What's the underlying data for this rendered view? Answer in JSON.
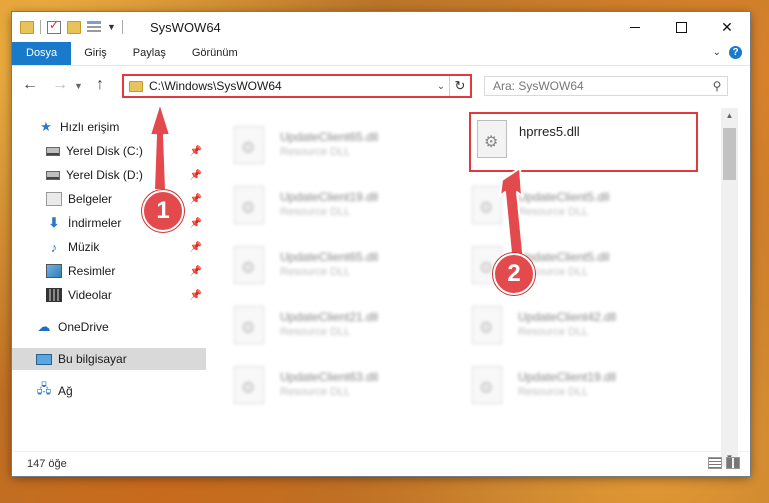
{
  "window": {
    "title": "SysWOW64",
    "controls": {
      "minimize": "—",
      "maximize": "☐",
      "close": "✕"
    }
  },
  "ribbon": {
    "tabs": [
      "Dosya",
      "Giriş",
      "Paylaş",
      "Görünüm"
    ],
    "active_tab": "Dosya"
  },
  "address": {
    "path": "C:\\Windows\\SysWOW64",
    "search_placeholder": "Ara: SysWOW64"
  },
  "sidebar": {
    "items": [
      {
        "label": "Hızlı erişim",
        "icon": "star-icon",
        "pinned": false
      },
      {
        "label": "Yerel Disk (C:)",
        "icon": "drive-icon",
        "pinned": true
      },
      {
        "label": "Yerel Disk (D:)",
        "icon": "drive-icon",
        "pinned": true
      },
      {
        "label": "Belgeler",
        "icon": "documents-icon",
        "pinned": true
      },
      {
        "label": "İndirmeler",
        "icon": "download-icon",
        "pinned": true
      },
      {
        "label": "Müzik",
        "icon": "music-icon",
        "pinned": true
      },
      {
        "label": "Resimler",
        "icon": "pictures-icon",
        "pinned": true
      },
      {
        "label": "Videolar",
        "icon": "videos-icon",
        "pinned": true
      },
      {
        "label": "OneDrive",
        "icon": "cloud-icon",
        "pinned": false
      },
      {
        "label": "Bu bilgisayar",
        "icon": "computer-icon",
        "pinned": false,
        "selected": true
      },
      {
        "label": "Ağ",
        "icon": "network-icon",
        "pinned": false
      }
    ]
  },
  "files": {
    "left": [
      {
        "name": "UpdateClient65.dll",
        "type": "Resource DLL"
      },
      {
        "name": "UpdateClient19.dll",
        "type": "Resource DLL"
      },
      {
        "name": "UpdateClient65.dll",
        "type": "Resource DLL"
      },
      {
        "name": "UpdateClient21.dll",
        "type": "Resource DLL"
      },
      {
        "name": "UpdateClient63.dll",
        "type": "Resource DLL"
      }
    ],
    "target": {
      "name": "hprres5.dll"
    },
    "right": [
      {
        "name": "UpdateClient5.dll",
        "type": "Resource DLL"
      },
      {
        "name": "UpdateClient5.dll",
        "type": "Resource DLL"
      },
      {
        "name": "UpdateClient42.dll",
        "type": "Resource DLL"
      },
      {
        "name": "UpdateClient19.dll",
        "type": "Resource DLL"
      }
    ]
  },
  "status": {
    "item_count": "147 öğe"
  },
  "annotations": {
    "badge1": "1",
    "badge2": "2",
    "color": "#e24a4e"
  }
}
